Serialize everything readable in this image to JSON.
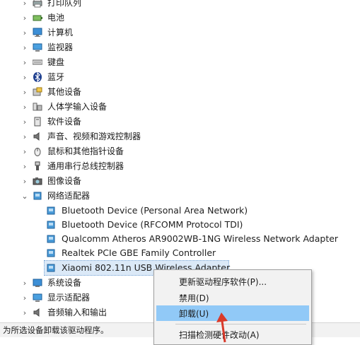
{
  "device_tree": {
    "categories": [
      {
        "label": "打印队列",
        "icon": "printer-queue-icon",
        "expanded": false
      },
      {
        "label": "电池",
        "icon": "battery-icon",
        "expanded": false
      },
      {
        "label": "计算机",
        "icon": "computer-icon",
        "expanded": false
      },
      {
        "label": "监视器",
        "icon": "monitor-icon",
        "expanded": false
      },
      {
        "label": "键盘",
        "icon": "keyboard-icon",
        "expanded": false
      },
      {
        "label": "蓝牙",
        "icon": "bluetooth-icon",
        "expanded": false
      },
      {
        "label": "其他设备",
        "icon": "other-devices-icon",
        "expanded": false
      },
      {
        "label": "人体学输入设备",
        "icon": "hid-icon",
        "expanded": false
      },
      {
        "label": "软件设备",
        "icon": "software-device-icon",
        "expanded": false
      },
      {
        "label": "声音、视频和游戏控制器",
        "icon": "speaker-icon",
        "expanded": false
      },
      {
        "label": "鼠标和其他指针设备",
        "icon": "mouse-icon",
        "expanded": false
      },
      {
        "label": "通用串行总线控制器",
        "icon": "usb-icon",
        "expanded": false
      },
      {
        "label": "图像设备",
        "icon": "camera-icon",
        "expanded": false
      },
      {
        "label": "网络适配器",
        "icon": "network-adapter-icon",
        "expanded": true
      }
    ],
    "network_adapters": [
      {
        "label": "Bluetooth Device (Personal Area Network)",
        "icon": "network-card-icon",
        "selected": false
      },
      {
        "label": "Bluetooth Device (RFCOMM Protocol TDI)",
        "icon": "network-card-icon",
        "selected": false
      },
      {
        "label": "Qualcomm Atheros AR9002WB-1NG Wireless Network Adapter",
        "icon": "network-card-icon",
        "selected": false
      },
      {
        "label": "Realtek PCIe GBE Family Controller",
        "icon": "network-card-icon",
        "selected": false
      },
      {
        "label": "Xiaomi 802.11n USB Wireless Adapter",
        "icon": "network-card-icon",
        "selected": true
      }
    ],
    "after_categories": [
      {
        "label": "系统设备",
        "icon": "system-device-icon",
        "expanded": false
      },
      {
        "label": "显示适配器",
        "icon": "display-adapter-icon",
        "expanded": false
      },
      {
        "label": "音频输入和输出",
        "icon": "audio-io-icon",
        "expanded": false
      }
    ]
  },
  "context_menu": {
    "items": [
      {
        "label": "更新驱动程序软件(P)...",
        "hover": false
      },
      {
        "label": "禁用(D)",
        "hover": false
      },
      {
        "label": "卸载(U)",
        "hover": true
      },
      {
        "label": "扫描检测硬件改动(A)",
        "hover": false
      }
    ]
  },
  "status_bar": {
    "text": "为所选设备卸载该驱动程序。"
  },
  "colors": {
    "selection_bg": "#dbe9f7",
    "menu_hover": "#91c9f7",
    "arrow": "#d93a2b",
    "icon_blue": "#2f7bbf"
  }
}
